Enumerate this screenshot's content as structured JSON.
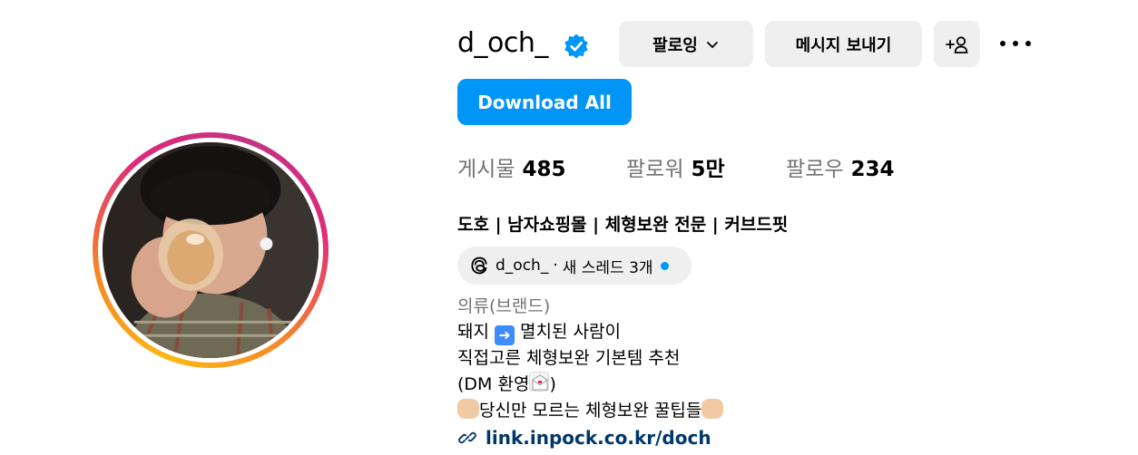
{
  "profile": {
    "username": "d_och_",
    "full_name": "도호 | 남자쇼핑몰 | 체형보완 전문 | 커브드핏",
    "category": "의류(브랜드)"
  },
  "actions": {
    "following_label": "팔로잉",
    "message_label": "메시지 보내기",
    "download_label": "Download All"
  },
  "stats": {
    "posts_label": "게시물",
    "posts_count": "485",
    "followers_label": "팔로워",
    "followers_count": "5만",
    "following_label": "팔로우",
    "following_count": "234"
  },
  "threads": {
    "name": "d_och_",
    "separator": "·",
    "text": "새 스레드 3개"
  },
  "bio": {
    "line1_a": "돼지 ",
    "line1_b": " 멸치된 사람이",
    "line2": "직접고른 체형보완 기본템 추천",
    "line3_a": "(DM 환영",
    "line3_b": ")",
    "line4": "당신만 모르는 체형보완 꿀팁들"
  },
  "link": {
    "text": "link.inpock.co.kr/doch"
  },
  "colors": {
    "primary_button": "#0095f6",
    "secondary_button": "#efefef",
    "muted_text": "#737373",
    "link_text": "#00376b",
    "verified_badge": "#0095f6"
  },
  "icons": {
    "verified": "verified-badge-icon",
    "chevron": "chevron-down-icon",
    "add_user": "add-user-icon",
    "more": "more-options-icon",
    "threads": "threads-icon",
    "link": "link-icon"
  }
}
